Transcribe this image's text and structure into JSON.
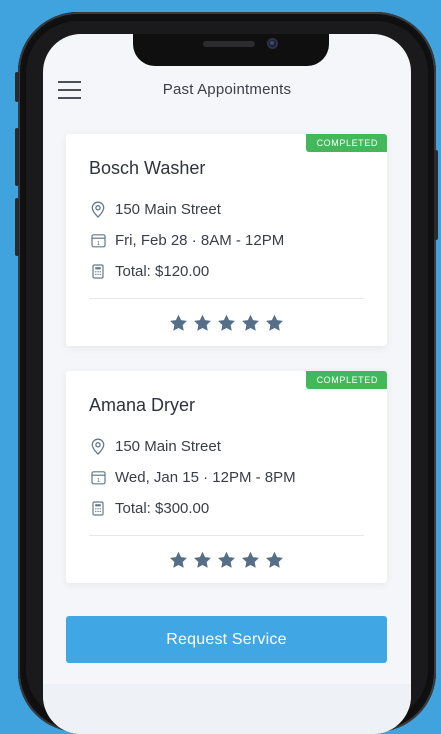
{
  "header": {
    "title": "Past Appointments"
  },
  "appointments": [
    {
      "status": "COMPLETED",
      "title": "Bosch Washer",
      "address": "150  Main Street",
      "datetime": "Fri, Feb 28 · 8AM - 12PM",
      "total": "Total: $120.00",
      "rating": 5
    },
    {
      "status": "COMPLETED",
      "title": "Amana Dryer",
      "address": "150  Main Street",
      "datetime": "Wed, Jan 15 · 12PM - 8PM",
      "total": "Total: $300.00",
      "rating": 5
    }
  ],
  "actions": {
    "request_service": "Request Service"
  },
  "colors": {
    "background": "#40a3de",
    "screen": "#f4f6f9",
    "badge_green": "#43b85a",
    "primary_button": "#40a6e4",
    "star": "#556f86",
    "icon": "#62798d"
  }
}
